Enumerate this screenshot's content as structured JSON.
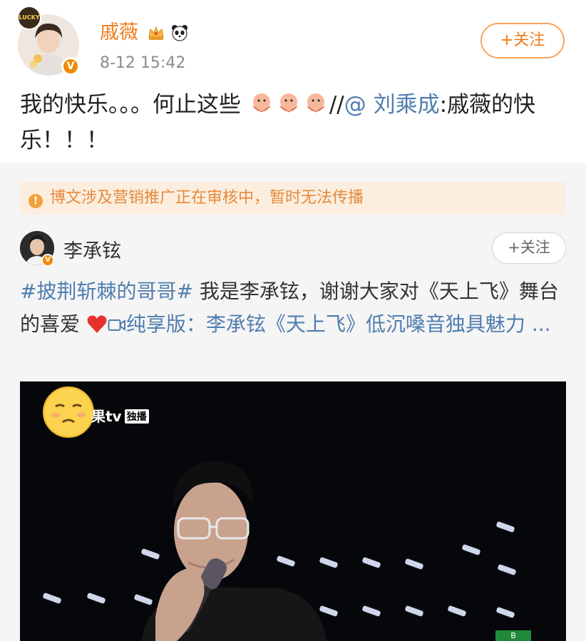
{
  "post": {
    "username": "戚薇",
    "timestamp": "8-12 15:42",
    "follow_label": "+关注",
    "text_main": "我的快乐。。。何止这些",
    "text_sep": "//",
    "mention": "@ 刘乘成",
    "text_after_mention": ":戚薇的快乐！！！",
    "avatar_badge": "LUCKY",
    "verified_label": "V",
    "badges": [
      "crown-icon",
      "panda-icon"
    ]
  },
  "repost": {
    "notice": "博文涉及营销推广正在审核中，暂时无法传播",
    "notice_icon_label": "!",
    "username": "李承铉",
    "follow_label": "+关注",
    "hashtag": "#披荆斩棘的哥哥#",
    "text_1": " 我是李承铉，谢谢大家对《天上飞》舞台的喜爱",
    "video_icon": "video-camera-icon",
    "link_text": "纯享版：李承铉《天上飞》低沉嗓音独具魅力",
    "ellipsis": " ...",
    "verified_label": "V"
  },
  "video": {
    "watermark": "果tv",
    "watermark_tag": "独播",
    "corner_logo": "B"
  },
  "colors": {
    "accent": "#f07a1a",
    "link": "#507daf",
    "notice_bg": "#fbeede",
    "notice_text": "#e7893a"
  }
}
